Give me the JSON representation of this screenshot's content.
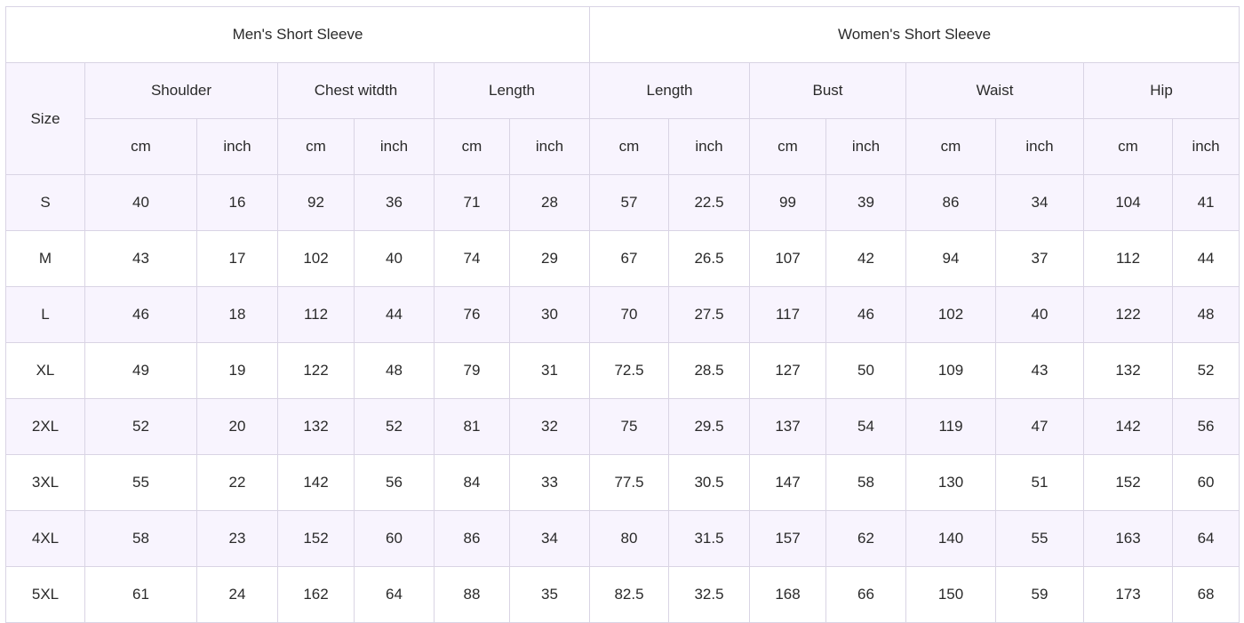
{
  "groups": {
    "men": "Men's Short Sleeve",
    "women": "Women's Short Sleeve"
  },
  "size_label": "Size",
  "measures": [
    "Shoulder",
    "Chest witdth",
    "Length",
    "Length",
    "Bust",
    "Waist",
    "Hip"
  ],
  "units": [
    "cm",
    "inch"
  ],
  "rows": [
    {
      "size": "S",
      "values": [
        "40",
        "16",
        "92",
        "36",
        "71",
        "28",
        "57",
        "22.5",
        "99",
        "39",
        "86",
        "34",
        "104",
        "41"
      ]
    },
    {
      "size": "M",
      "values": [
        "43",
        "17",
        "102",
        "40",
        "74",
        "29",
        "67",
        "26.5",
        "107",
        "42",
        "94",
        "37",
        "112",
        "44"
      ]
    },
    {
      "size": "L",
      "values": [
        "46",
        "18",
        "112",
        "44",
        "76",
        "30",
        "70",
        "27.5",
        "117",
        "46",
        "102",
        "40",
        "122",
        "48"
      ]
    },
    {
      "size": "XL",
      "values": [
        "49",
        "19",
        "122",
        "48",
        "79",
        "31",
        "72.5",
        "28.5",
        "127",
        "50",
        "109",
        "43",
        "132",
        "52"
      ]
    },
    {
      "size": "2XL",
      "values": [
        "52",
        "20",
        "132",
        "52",
        "81",
        "32",
        "75",
        "29.5",
        "137",
        "54",
        "119",
        "47",
        "142",
        "56"
      ]
    },
    {
      "size": "3XL",
      "values": [
        "55",
        "22",
        "142",
        "56",
        "84",
        "33",
        "77.5",
        "30.5",
        "147",
        "58",
        "130",
        "51",
        "152",
        "60"
      ]
    },
    {
      "size": "4XL",
      "values": [
        "58",
        "23",
        "152",
        "60",
        "86",
        "34",
        "80",
        "31.5",
        "157",
        "62",
        "140",
        "55",
        "163",
        "64"
      ]
    },
    {
      "size": "5XL",
      "values": [
        "61",
        "24",
        "162",
        "64",
        "88",
        "35",
        "82.5",
        "32.5",
        "168",
        "66",
        "150",
        "59",
        "173",
        "68"
      ]
    }
  ]
}
